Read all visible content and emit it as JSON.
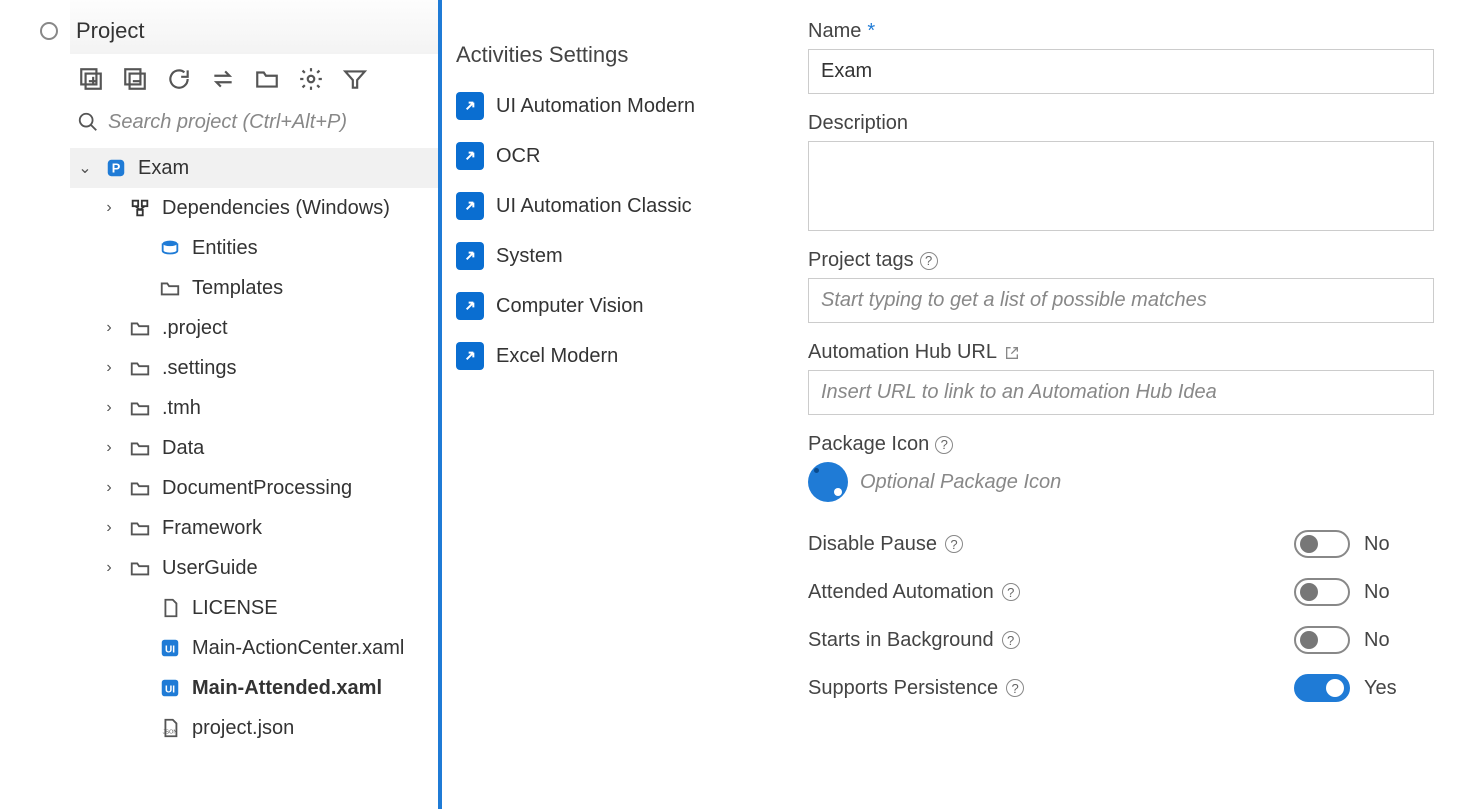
{
  "project_panel": {
    "title": "Project",
    "search_placeholder": "Search project (Ctrl+Alt+P)",
    "root": {
      "label": "Exam"
    },
    "tree": [
      {
        "label": "Dependencies (Windows)",
        "has_children": true,
        "icon": "deps"
      },
      {
        "label": "Entities",
        "has_children": false,
        "icon": "entities"
      },
      {
        "label": "Templates",
        "has_children": false,
        "icon": "folder"
      },
      {
        "label": ".project",
        "has_children": true,
        "icon": "folder"
      },
      {
        "label": ".settings",
        "has_children": true,
        "icon": "folder"
      },
      {
        "label": ".tmh",
        "has_children": true,
        "icon": "folder"
      },
      {
        "label": "Data",
        "has_children": true,
        "icon": "folder"
      },
      {
        "label": "DocumentProcessing",
        "has_children": true,
        "icon": "folder"
      },
      {
        "label": "Framework",
        "has_children": true,
        "icon": "folder"
      },
      {
        "label": "UserGuide",
        "has_children": true,
        "icon": "folder"
      },
      {
        "label": "LICENSE",
        "has_children": false,
        "icon": "file"
      },
      {
        "label": "Main-ActionCenter.xaml",
        "has_children": false,
        "icon": "xaml"
      },
      {
        "label": "Main-Attended.xaml",
        "has_children": false,
        "icon": "xaml",
        "bold": true
      },
      {
        "label": "project.json",
        "has_children": false,
        "icon": "json"
      }
    ]
  },
  "activities": {
    "title": "Activities Settings",
    "items": [
      "UI Automation Modern",
      "OCR",
      "UI Automation Classic",
      "System",
      "Computer Vision",
      "Excel Modern"
    ]
  },
  "props": {
    "name_label": "Name",
    "name_value": "Exam",
    "description_label": "Description",
    "description_value": "",
    "tags_label": "Project tags",
    "tags_placeholder": "Start typing to get a list of possible matches",
    "hub_label": "Automation Hub URL",
    "hub_placeholder": "Insert URL to link to an Automation Hub Idea",
    "pkg_label": "Package Icon",
    "pkg_placeholder": "Optional Package Icon",
    "toggles": {
      "disable_pause": {
        "label": "Disable Pause",
        "value": "No",
        "on": false
      },
      "attended": {
        "label": "Attended Automation",
        "value": "No",
        "on": false
      },
      "starts_bg": {
        "label": "Starts in Background",
        "value": "No",
        "on": false
      },
      "persistence": {
        "label": "Supports Persistence",
        "value": "Yes",
        "on": true
      }
    }
  }
}
